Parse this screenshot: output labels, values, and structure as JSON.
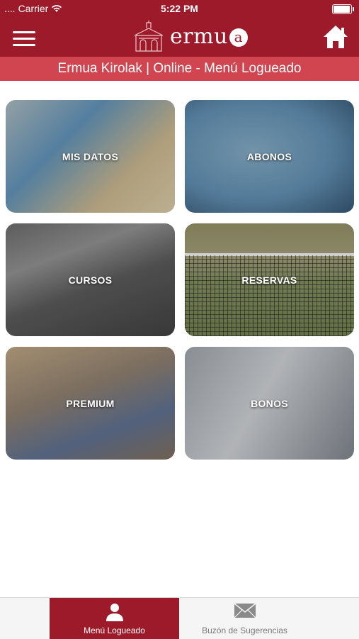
{
  "status": {
    "carrier": "Carrier",
    "time": "5:22 PM"
  },
  "header": {
    "logo_text": "ermu",
    "logo_letter": "a",
    "subtitle": "Ermua Kirolak | Online - Menú Logueado"
  },
  "tiles": [
    {
      "label": "MIS DATOS"
    },
    {
      "label": "ABONOS"
    },
    {
      "label": "CURSOS"
    },
    {
      "label": "RESERVAS"
    },
    {
      "label": "PREMIUM"
    },
    {
      "label": "BONOS"
    }
  ],
  "tabbar": {
    "items": [
      {
        "label": "Menú Logueado",
        "icon": "user-icon",
        "active": true
      },
      {
        "label": "Buzón de Sugerencias",
        "icon": "envelope-icon",
        "active": false
      }
    ]
  },
  "colors": {
    "brand": "#9c1a2a",
    "subtitle_bar": "#d0454f"
  }
}
